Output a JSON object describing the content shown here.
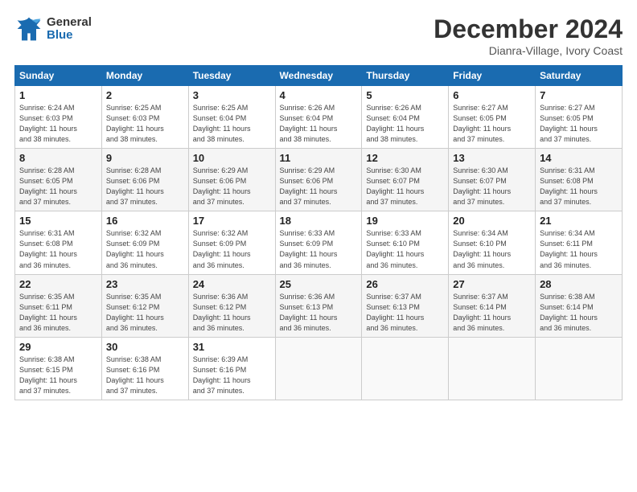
{
  "header": {
    "logo_general": "General",
    "logo_blue": "Blue",
    "title": "December 2024",
    "location": "Dianra-Village, Ivory Coast"
  },
  "days_of_week": [
    "Sunday",
    "Monday",
    "Tuesday",
    "Wednesday",
    "Thursday",
    "Friday",
    "Saturday"
  ],
  "weeks": [
    [
      {
        "day": "1",
        "info": "Sunrise: 6:24 AM\nSunset: 6:03 PM\nDaylight: 11 hours\nand 38 minutes."
      },
      {
        "day": "2",
        "info": "Sunrise: 6:25 AM\nSunset: 6:03 PM\nDaylight: 11 hours\nand 38 minutes."
      },
      {
        "day": "3",
        "info": "Sunrise: 6:25 AM\nSunset: 6:04 PM\nDaylight: 11 hours\nand 38 minutes."
      },
      {
        "day": "4",
        "info": "Sunrise: 6:26 AM\nSunset: 6:04 PM\nDaylight: 11 hours\nand 38 minutes."
      },
      {
        "day": "5",
        "info": "Sunrise: 6:26 AM\nSunset: 6:04 PM\nDaylight: 11 hours\nand 38 minutes."
      },
      {
        "day": "6",
        "info": "Sunrise: 6:27 AM\nSunset: 6:05 PM\nDaylight: 11 hours\nand 37 minutes."
      },
      {
        "day": "7",
        "info": "Sunrise: 6:27 AM\nSunset: 6:05 PM\nDaylight: 11 hours\nand 37 minutes."
      }
    ],
    [
      {
        "day": "8",
        "info": "Sunrise: 6:28 AM\nSunset: 6:05 PM\nDaylight: 11 hours\nand 37 minutes."
      },
      {
        "day": "9",
        "info": "Sunrise: 6:28 AM\nSunset: 6:06 PM\nDaylight: 11 hours\nand 37 minutes."
      },
      {
        "day": "10",
        "info": "Sunrise: 6:29 AM\nSunset: 6:06 PM\nDaylight: 11 hours\nand 37 minutes."
      },
      {
        "day": "11",
        "info": "Sunrise: 6:29 AM\nSunset: 6:06 PM\nDaylight: 11 hours\nand 37 minutes."
      },
      {
        "day": "12",
        "info": "Sunrise: 6:30 AM\nSunset: 6:07 PM\nDaylight: 11 hours\nand 37 minutes."
      },
      {
        "day": "13",
        "info": "Sunrise: 6:30 AM\nSunset: 6:07 PM\nDaylight: 11 hours\nand 37 minutes."
      },
      {
        "day": "14",
        "info": "Sunrise: 6:31 AM\nSunset: 6:08 PM\nDaylight: 11 hours\nand 37 minutes."
      }
    ],
    [
      {
        "day": "15",
        "info": "Sunrise: 6:31 AM\nSunset: 6:08 PM\nDaylight: 11 hours\nand 36 minutes."
      },
      {
        "day": "16",
        "info": "Sunrise: 6:32 AM\nSunset: 6:09 PM\nDaylight: 11 hours\nand 36 minutes."
      },
      {
        "day": "17",
        "info": "Sunrise: 6:32 AM\nSunset: 6:09 PM\nDaylight: 11 hours\nand 36 minutes."
      },
      {
        "day": "18",
        "info": "Sunrise: 6:33 AM\nSunset: 6:09 PM\nDaylight: 11 hours\nand 36 minutes."
      },
      {
        "day": "19",
        "info": "Sunrise: 6:33 AM\nSunset: 6:10 PM\nDaylight: 11 hours\nand 36 minutes."
      },
      {
        "day": "20",
        "info": "Sunrise: 6:34 AM\nSunset: 6:10 PM\nDaylight: 11 hours\nand 36 minutes."
      },
      {
        "day": "21",
        "info": "Sunrise: 6:34 AM\nSunset: 6:11 PM\nDaylight: 11 hours\nand 36 minutes."
      }
    ],
    [
      {
        "day": "22",
        "info": "Sunrise: 6:35 AM\nSunset: 6:11 PM\nDaylight: 11 hours\nand 36 minutes."
      },
      {
        "day": "23",
        "info": "Sunrise: 6:35 AM\nSunset: 6:12 PM\nDaylight: 11 hours\nand 36 minutes."
      },
      {
        "day": "24",
        "info": "Sunrise: 6:36 AM\nSunset: 6:12 PM\nDaylight: 11 hours\nand 36 minutes."
      },
      {
        "day": "25",
        "info": "Sunrise: 6:36 AM\nSunset: 6:13 PM\nDaylight: 11 hours\nand 36 minutes."
      },
      {
        "day": "26",
        "info": "Sunrise: 6:37 AM\nSunset: 6:13 PM\nDaylight: 11 hours\nand 36 minutes."
      },
      {
        "day": "27",
        "info": "Sunrise: 6:37 AM\nSunset: 6:14 PM\nDaylight: 11 hours\nand 36 minutes."
      },
      {
        "day": "28",
        "info": "Sunrise: 6:38 AM\nSunset: 6:14 PM\nDaylight: 11 hours\nand 36 minutes."
      }
    ],
    [
      {
        "day": "29",
        "info": "Sunrise: 6:38 AM\nSunset: 6:15 PM\nDaylight: 11 hours\nand 37 minutes."
      },
      {
        "day": "30",
        "info": "Sunrise: 6:38 AM\nSunset: 6:16 PM\nDaylight: 11 hours\nand 37 minutes."
      },
      {
        "day": "31",
        "info": "Sunrise: 6:39 AM\nSunset: 6:16 PM\nDaylight: 11 hours\nand 37 minutes."
      },
      {
        "day": "",
        "info": ""
      },
      {
        "day": "",
        "info": ""
      },
      {
        "day": "",
        "info": ""
      },
      {
        "day": "",
        "info": ""
      }
    ]
  ]
}
